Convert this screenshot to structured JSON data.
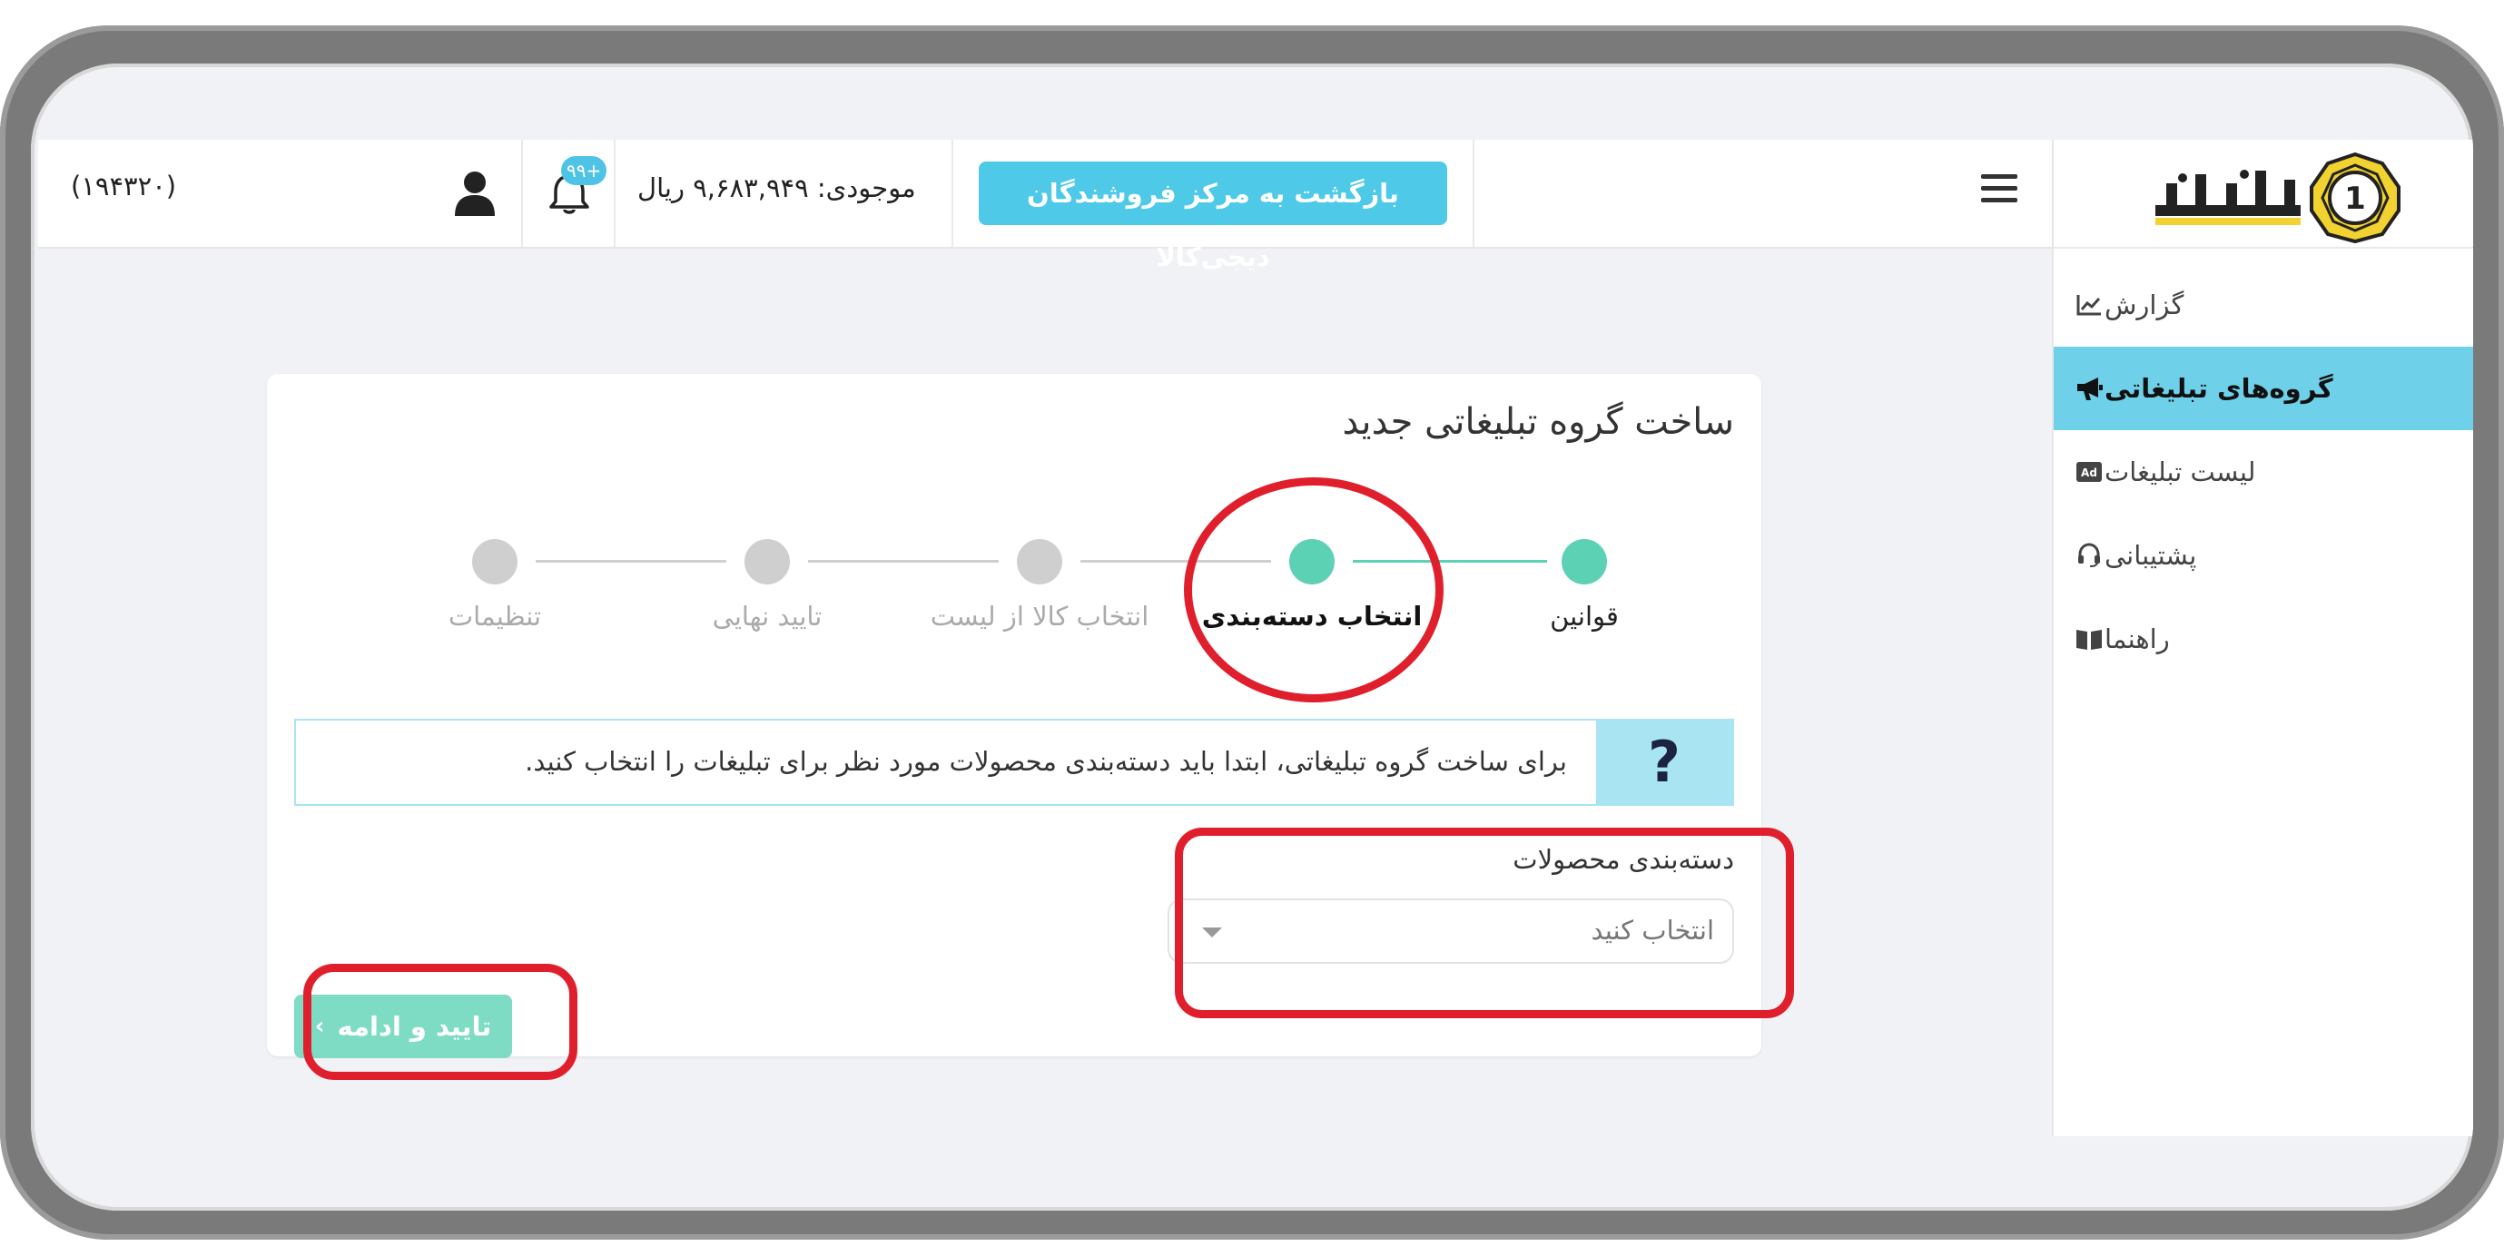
{
  "header": {
    "user_id": "(۱۹۴۳۲۰)",
    "notification_badge": "۹۹+",
    "balance": "موجودی: ۹,۶۸۳,۹۴۹ ریال",
    "back_button": "بازگشت به مرکز فروشندگان دیجی‌کالا"
  },
  "logo": {
    "name": "یکتانت"
  },
  "sidebar": {
    "items": [
      {
        "label": "گزارش",
        "icon": "chart-line-icon",
        "active": false
      },
      {
        "label": "گروه‌های تبلیغاتی",
        "icon": "megaphone-icon",
        "active": true
      },
      {
        "label": "لیست تبلیغات",
        "icon": "ad-icon",
        "active": false
      },
      {
        "label": "پشتیبانی",
        "icon": "headset-icon",
        "active": false
      },
      {
        "label": "راهنما",
        "icon": "book-icon",
        "active": false
      }
    ]
  },
  "page": {
    "title": "ساخت گروه تبلیغاتی جدید",
    "steps": [
      {
        "label": "قوانین",
        "state": "done"
      },
      {
        "label": "انتخاب دسته‌بندی",
        "state": "current"
      },
      {
        "label": "انتخاب کالا از لیست",
        "state": "pending"
      },
      {
        "label": "تایید نهایی",
        "state": "pending"
      },
      {
        "label": "تنظیمات",
        "state": "pending"
      }
    ],
    "info_icon": "?",
    "info_text": "برای ساخت گروه تبلیغاتی، ابتدا باید دسته‌بندی محصولات مورد نظر برای تبلیغات را انتخاب کنید.",
    "category_label": "دسته‌بندی محصولات",
    "category_placeholder": "انتخاب کنید",
    "continue_button": "تایید و ادامه"
  },
  "colors": {
    "accent": "#4fc9e8",
    "active_menu": "#6fd0ea",
    "step_done": "#5cd1b4",
    "step_pending": "#cfcfcf",
    "continue_button": "#7fdcc4",
    "annotation": "#e01f2d"
  }
}
